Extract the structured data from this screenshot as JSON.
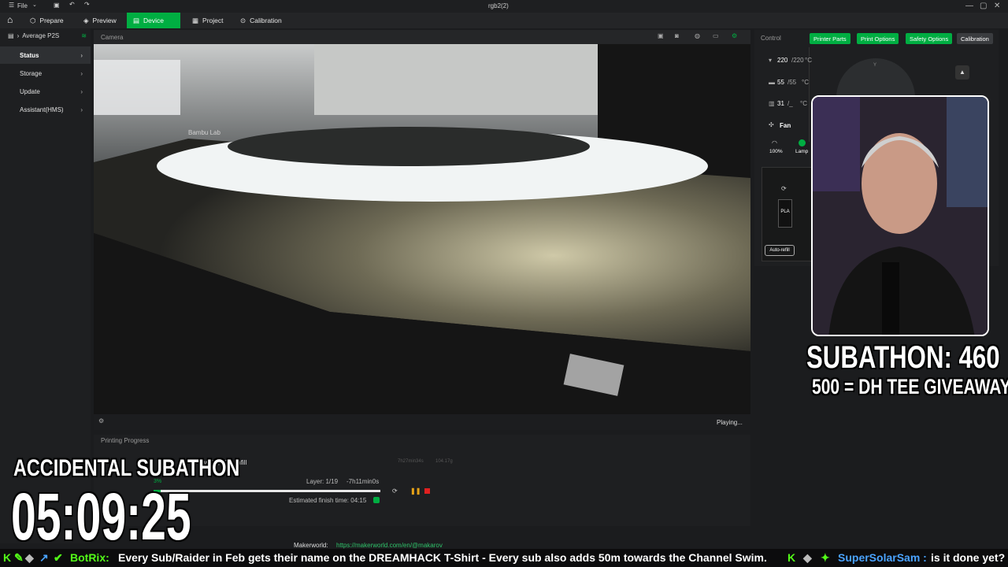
{
  "window": {
    "title": "rgb2(2)"
  },
  "titlebar": {
    "file_label": "File"
  },
  "nav": {
    "tabs": [
      {
        "label": "Prepare"
      },
      {
        "label": "Preview"
      },
      {
        "label": "Device"
      },
      {
        "label": "Project"
      },
      {
        "label": "Calibration"
      }
    ],
    "active": "Device"
  },
  "sidebar": {
    "printer": "Average P2S",
    "items": [
      {
        "label": "Status"
      },
      {
        "label": "Storage"
      },
      {
        "label": "Update"
      },
      {
        "label": "Assistant(HMS)"
      }
    ]
  },
  "camera": {
    "title": "Camera",
    "status": "Playing...",
    "overlay_brand": "Bambu Lab"
  },
  "progress": {
    "title": "Printing Progress",
    "job_desc": "walls, 15% infill",
    "time_est": "7h27min34s",
    "weight": "104.17g",
    "layer": "Layer: 1/19",
    "remaining": "-7h11min0s",
    "finish": "Estimated finish time: 04:15",
    "percent_label": "3%",
    "percent": 3
  },
  "control": {
    "title": "Control",
    "buttons": [
      {
        "label": "Printer Parts"
      },
      {
        "label": "Print Options"
      },
      {
        "label": "Safety Options"
      },
      {
        "label": "Calibration"
      }
    ],
    "nozzle": {
      "current": "220",
      "target": "/220",
      "unit": "°C"
    },
    "bed": {
      "current": "55",
      "target": "/55",
      "unit": "°C"
    },
    "chamber": {
      "current": "31",
      "target": "/_",
      "unit": "°C"
    },
    "fan_label": "Fan",
    "fan_speed": "100%",
    "lamp_label": "Lamp",
    "filament": "PLA",
    "autorefill": "Auto-refill"
  },
  "overlay": {
    "subathon": "SUBATHON: 460",
    "giveaway": "500 = DH TEE GIVEAWAY",
    "accidental": "ACCIDENTAL SUBATHON",
    "timer": "05:09:25"
  },
  "makerworld": {
    "label": "Makerworld:",
    "url": "https://makerworld.com/en/@makarov"
  },
  "ticker": {
    "bot": "BotRix:",
    "message": "Every Sub/Raider in Feb gets their name on the DREAMHACK T-Shirt - Every sub also adds 50m towards the Channel Swim.",
    "user": "SuperSolarSam :",
    "user_msg": "is it done yet?"
  },
  "colors": {
    "accent": "#00ae42",
    "bg": "#1b1c1e",
    "panel": "#1e1f21",
    "pause": "#e8a317",
    "stop": "#e02020"
  }
}
